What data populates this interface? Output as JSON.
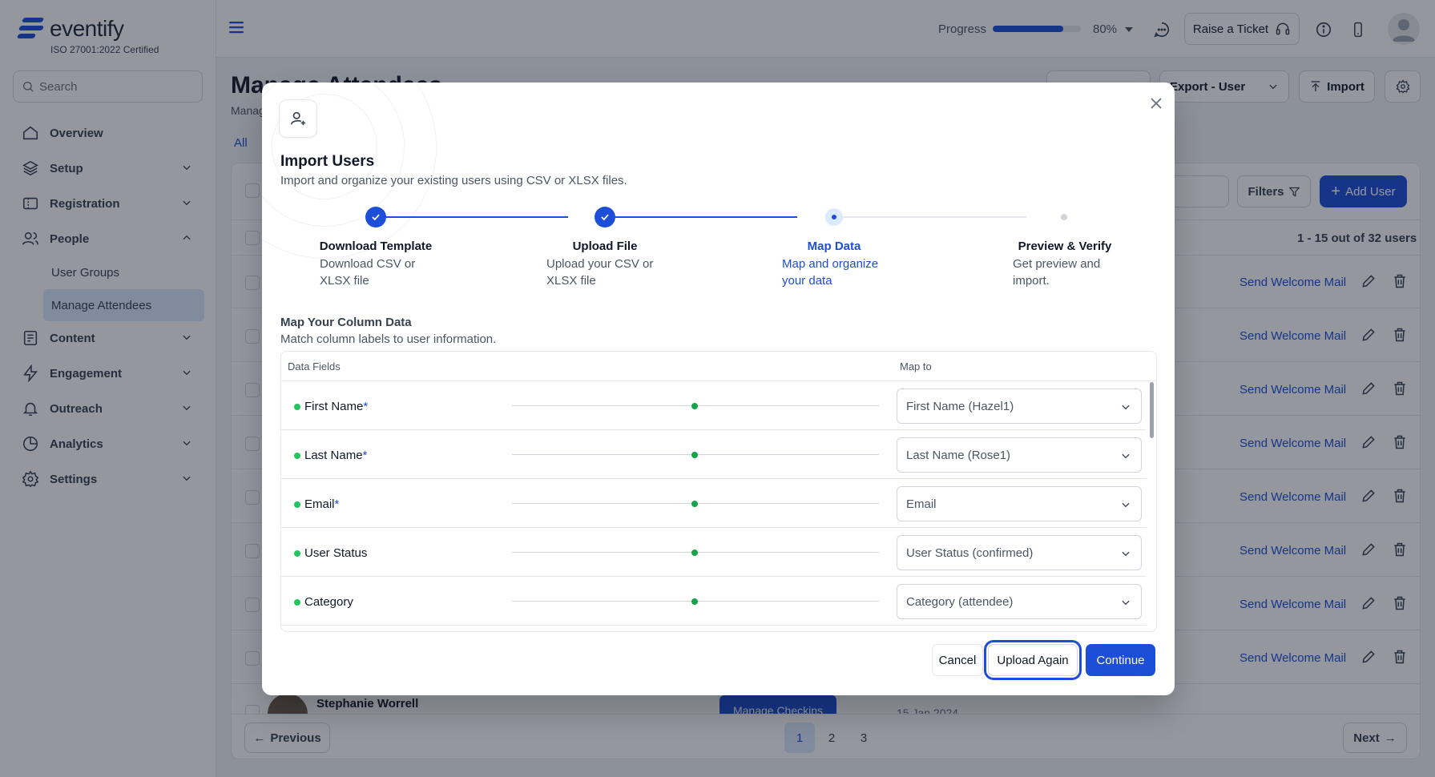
{
  "brand": {
    "name": "eventify",
    "certification": "ISO 27001:2022 Certified"
  },
  "sidebar": {
    "search_placeholder": "Search",
    "items": [
      {
        "label": "Overview",
        "icon": "home-icon"
      },
      {
        "label": "Setup",
        "icon": "layers-icon"
      },
      {
        "label": "Registration",
        "icon": "ticket-icon"
      },
      {
        "label": "People",
        "icon": "users-icon",
        "expanded": true
      },
      {
        "label": "Content",
        "icon": "document-icon"
      },
      {
        "label": "Engagement",
        "icon": "bolt-icon"
      },
      {
        "label": "Outreach",
        "icon": "bell-icon"
      },
      {
        "label": "Analytics",
        "icon": "pie-chart-icon"
      },
      {
        "label": "Settings",
        "icon": "gear-icon"
      }
    ],
    "people_subitems": [
      "User Groups",
      "Manage Attendees"
    ],
    "active_subitem": "Manage Attendees"
  },
  "header": {
    "progress_label": "Progress",
    "progress_percent": 80,
    "progress_value": "80%",
    "raise_ticket_label": "Raise a Ticket"
  },
  "page": {
    "title": "Manage Attendees",
    "subtitle": "Manag",
    "tab_all": "All",
    "export_label": "Export - User",
    "import_label": "Import",
    "filters_label": "Filters",
    "add_user_label": "Add User",
    "count_text": "1 - 15 out of 32 users",
    "row_action": "Send Welcome Mail",
    "visible_user_name": "Stephanie Worrell",
    "manage_checkins": "Manage Checkins",
    "visible_date": "15 Jan 2024",
    "pagination": {
      "previous": "Previous",
      "next": "Next",
      "pages": [
        "1",
        "2",
        "3"
      ],
      "current": "1"
    }
  },
  "modal": {
    "title": "Import Users",
    "subtitle": "Import and organize your existing users using CSV or XLSX files.",
    "steps": [
      {
        "title": "Download Template",
        "desc": "Download CSV or XLSX file",
        "state": "done"
      },
      {
        "title": "Upload File",
        "desc": "Upload your CSV or XLSX file",
        "state": "done"
      },
      {
        "title": "Map Data",
        "desc": "Map and organize your data",
        "state": "current"
      },
      {
        "title": "Preview & Verify",
        "desc": "Get preview and import.",
        "state": "pending"
      }
    ],
    "map_title": "Map Your Column Data",
    "map_subtitle": "Match column labels to user information.",
    "col_data_fields": "Data Fields",
    "col_map_to": "Map to",
    "fields": [
      {
        "label": "First Name",
        "required": true,
        "mapped_to": "First Name (Hazel1)"
      },
      {
        "label": "Last Name",
        "required": true,
        "mapped_to": "Last Name (Rose1)"
      },
      {
        "label": "Email",
        "required": true,
        "mapped_to": "Email"
      },
      {
        "label": "User Status",
        "required": false,
        "mapped_to": "User Status (confirmed)"
      },
      {
        "label": "Category",
        "required": false,
        "mapped_to": "Category (attendee)"
      }
    ],
    "required_mark": "*",
    "cancel_label": "Cancel",
    "upload_again_label": "Upload Again",
    "continue_label": "Continue"
  },
  "colors": {
    "primary": "#1d4ed8",
    "mapped_dot": "#22c55e",
    "active_nav_bg": "#dbeafe"
  }
}
